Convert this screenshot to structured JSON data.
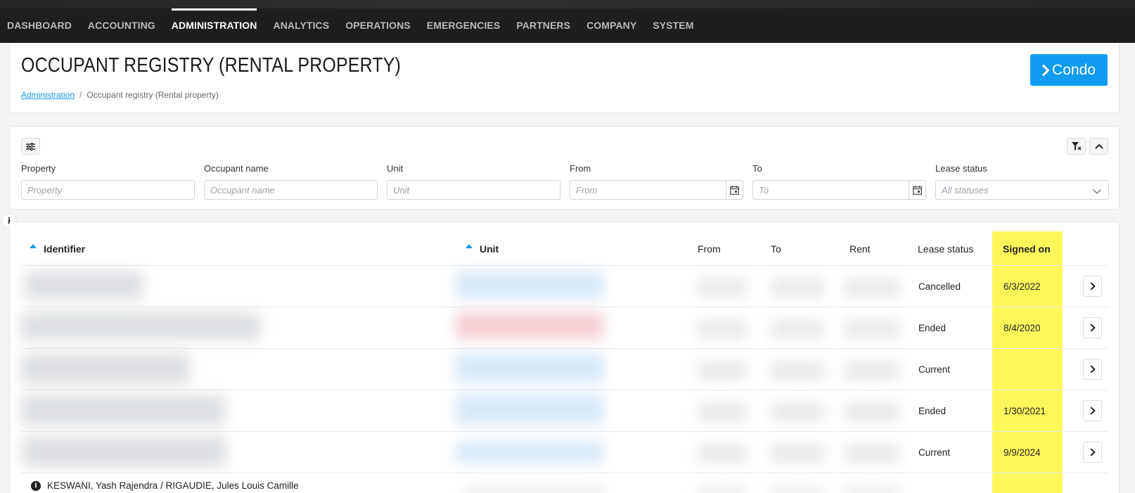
{
  "nav": {
    "items": [
      {
        "label": "DASHBOARD",
        "active": false
      },
      {
        "label": "ACCOUNTING",
        "active": false
      },
      {
        "label": "ADMINISTRATION",
        "active": true
      },
      {
        "label": "ANALYTICS",
        "active": false
      },
      {
        "label": "OPERATIONS",
        "active": false
      },
      {
        "label": "EMERGENCIES",
        "active": false
      },
      {
        "label": "PARTNERS",
        "active": false
      },
      {
        "label": "COMPANY",
        "active": false
      },
      {
        "label": "SYSTEM",
        "active": false
      }
    ]
  },
  "header": {
    "title": "OCCUPANT REGISTRY (RENTAL PROPERTY)",
    "breadcrumb_link": "Administration",
    "breadcrumb_sep": "/",
    "breadcrumb_current": "Occupant registry (Rental property)",
    "condo_button": "Condo"
  },
  "filters": {
    "property_label": "Property",
    "property_placeholder": "Property",
    "occupant_label": "Occupant name",
    "occupant_placeholder": "Occupant name",
    "unit_label": "Unit",
    "unit_placeholder": "Unit",
    "from_label": "From",
    "from_placeholder": "From",
    "to_label": "To",
    "to_placeholder": "To",
    "status_label": "Lease status",
    "status_value": "All statuses"
  },
  "table": {
    "columns": {
      "identifier": "Identifier",
      "unit": "Unit",
      "from": "From",
      "to": "To",
      "rent": "Rent",
      "lease_status": "Lease status",
      "signed_on": "Signed on"
    },
    "rows": [
      {
        "lease_status": "Cancelled",
        "signed_on": "6/3/2022"
      },
      {
        "lease_status": "Ended",
        "signed_on": "8/4/2020"
      },
      {
        "lease_status": "Current",
        "signed_on": ""
      },
      {
        "lease_status": "Ended",
        "signed_on": "1/30/2021"
      },
      {
        "lease_status": "Current",
        "signed_on": "9/9/2024"
      }
    ],
    "last_row_identifier": "KESWANI, Yash Rajendra / RIGAUDIE, Jules Louis Camille"
  },
  "colors": {
    "accent": "#0f9cf0",
    "highlight": "#fff75a",
    "topbar": "#1e1e1e"
  }
}
